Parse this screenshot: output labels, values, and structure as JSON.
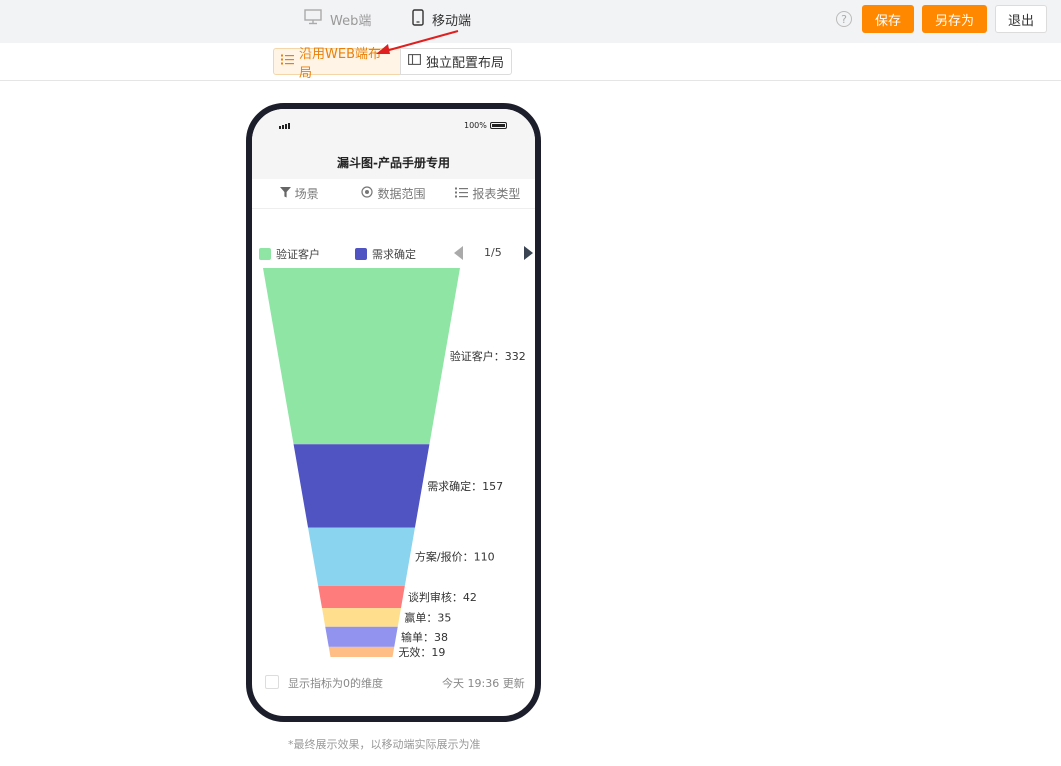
{
  "topbar": {
    "tabs": [
      {
        "label": "Web端",
        "icon": "monitor-icon"
      },
      {
        "label": "移动端",
        "icon": "mobile-icon"
      }
    ],
    "help_icon": "help-icon",
    "save_label": "保存",
    "save_as_label": "另存为",
    "exit_label": "退出",
    "accent_color": "#ff8800"
  },
  "layout_bar": {
    "web_layout_label": "沿用WEB端布局",
    "independent_layout_label": "独立配置布局"
  },
  "phone": {
    "battery_text": "100%",
    "title": "漏斗图-产品手册专用",
    "filters": [
      {
        "label": "场景",
        "icon": "filter-icon"
      },
      {
        "label": "数据范围",
        "icon": "target-icon"
      },
      {
        "label": "报表类型",
        "icon": "list-icon"
      }
    ],
    "legend": [
      {
        "label": "验证客户",
        "color": "#8ee5a4"
      },
      {
        "label": "需求确定",
        "color": "#5053c2"
      }
    ],
    "pager": "1/5",
    "footer_check_label": "显示指标为0的维度",
    "footer_time": "今天 19:36 更新"
  },
  "chart_data": {
    "type": "funnel",
    "categories": [
      "验证客户",
      "需求确定",
      "方案/报价",
      "谈判审核",
      "赢单",
      "输单",
      "无效"
    ],
    "values": [
      332,
      157,
      110,
      42,
      35,
      38,
      19
    ],
    "labels": [
      "验证客户：332",
      "需求确定：157",
      "方案/报价：110",
      "谈判审核：42",
      "赢单：35",
      "输单：38",
      "无效：19"
    ],
    "colors": [
      "#8ee5a4",
      "#5053c2",
      "#8ad4f0",
      "#fe7c7c",
      "#ffdf8e",
      "#9193ef",
      "#ffbe85"
    ]
  },
  "note": "*最终展示效果，以移动端实际展示为准"
}
